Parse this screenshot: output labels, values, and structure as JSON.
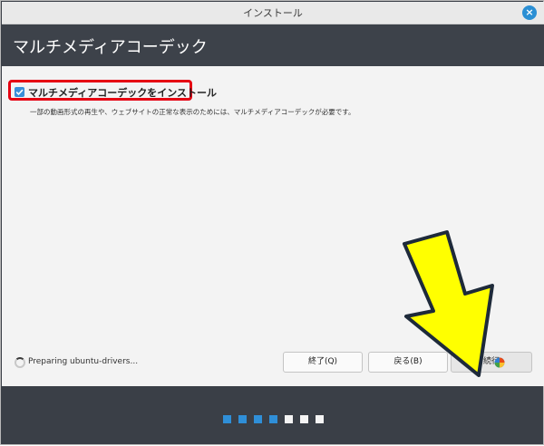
{
  "window": {
    "title": "インストール"
  },
  "header": {
    "title": "マルチメディアコーデック"
  },
  "content": {
    "checkbox_label": "マルチメディアコーデックをインストール",
    "checkbox_checked": true,
    "description": "一部の動画形式の再生や、ウェブサイトの正常な表示のためには、マルチメディアコーデックが必要です。"
  },
  "status": {
    "text": "Preparing ubuntu-drivers..."
  },
  "buttons": {
    "quit": "終了(Q)",
    "back": "戻る(B)",
    "continue": "続行"
  },
  "progress": {
    "total_steps": 7,
    "completed_steps": 4
  },
  "colors": {
    "accent": "#3a8fd8",
    "highlight_red": "#e60012",
    "arrow_yellow": "#ffff00",
    "header_bg": "#3d424a"
  }
}
